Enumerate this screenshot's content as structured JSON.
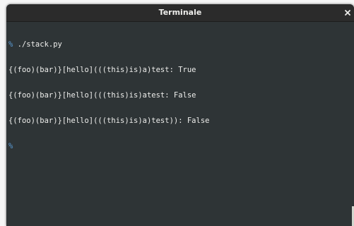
{
  "window": {
    "title": "Terminale",
    "close_glyph": "close-icon"
  },
  "terminal": {
    "lines": [
      {
        "prompt": "%",
        "text": " ./stack.py"
      },
      {
        "prompt": "",
        "text": "{(foo)(bar)}[hello](((this)is)a)test: True"
      },
      {
        "prompt": "",
        "text": "{(foo)(bar)}[hello](((this)is)atest: False"
      },
      {
        "prompt": "",
        "text": "{(foo)(bar)}[hello](((this)is)a)test)): False"
      },
      {
        "prompt": "%",
        "text": ""
      }
    ]
  },
  "colors": {
    "terminal_bg": "#2e3436",
    "terminal_fg": "#eeeeec",
    "prompt": "#5a9bd5",
    "titlebar_bg": "#2b2b2b"
  }
}
